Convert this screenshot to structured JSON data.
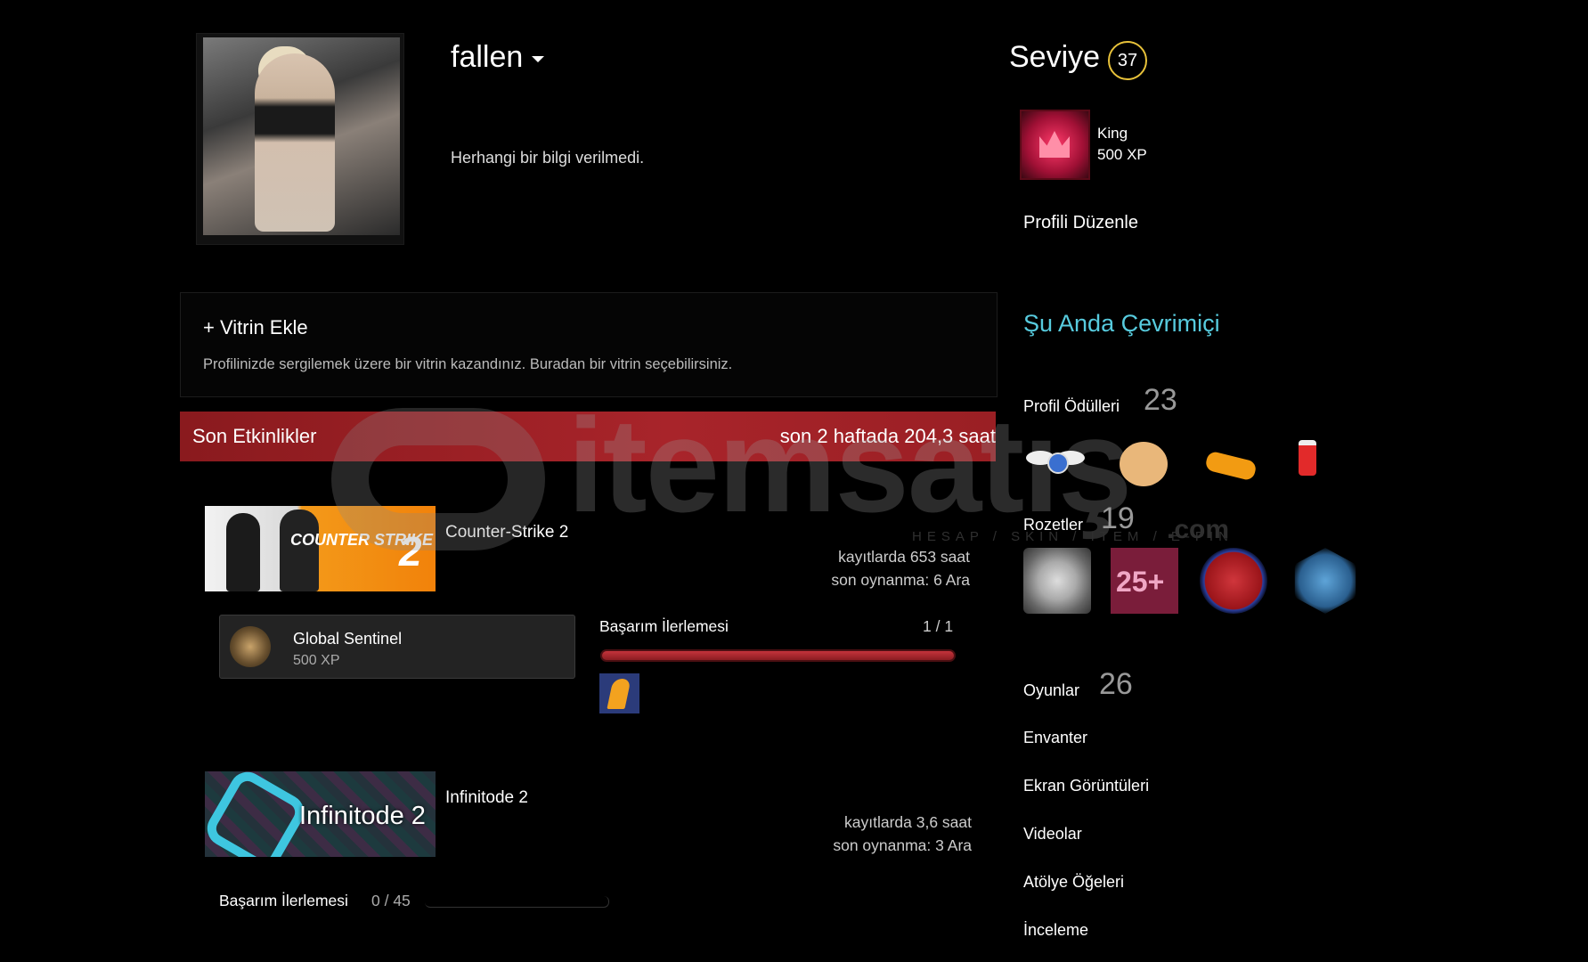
{
  "profile": {
    "username": "fallen",
    "summary": "Herhangi bir bilgi verilmedi."
  },
  "showcase": {
    "title": "+ Vitrin Ekle",
    "description": "Profilinizde sergilemek üzere bir vitrin kazandınız. Buradan bir vitrin seçebilirsiniz."
  },
  "activity": {
    "title": "Son Etkinlikler",
    "hours_summary": "son 2 haftada 204,3 saat",
    "games": [
      {
        "name": "Counter-Strike 2",
        "capsule_text": "COUNTER STRIKE",
        "capsule_number": "2",
        "hours": "kayıtlarda 653 saat",
        "last_played": "son oynanma: 6 Ara",
        "achievement": {
          "name": "Global Sentinel",
          "xp": "500 XP"
        },
        "progress_label": "Başarım İlerlemesi",
        "progress_count": "1 / 1",
        "progress_fraction": 1.0
      },
      {
        "name": "Infinitode 2",
        "capsule_text": "Infinitode 2",
        "hours": "kayıtlarda 3,6 saat",
        "last_played": "son oynanma: 3 Ara",
        "progress_label": "Başarım İlerlemesi",
        "progress_count": "0 / 45",
        "progress_fraction": 0.0
      }
    ]
  },
  "watermark": {
    "text": "itemsatış",
    "sub": "HESAP / SKIN / ITEM / E-PIN",
    "com": ".com"
  },
  "sidebar": {
    "level_label": "Seviye",
    "level": "37",
    "badge": {
      "name": "King",
      "xp": "500 XP"
    },
    "edit_profile": "Profili Düzenle",
    "status": "Şu Anda Çevrimiçi",
    "rewards": {
      "label": "Profil Ödülleri",
      "count": "23"
    },
    "badges": {
      "label": "Rozetler",
      "count": "19",
      "badge_25_text": "25+"
    },
    "games": {
      "label": "Oyunlar",
      "count": "26"
    },
    "links": [
      "Envanter",
      "Ekran Görüntüleri",
      "Videolar",
      "Atölye Öğeleri",
      "İnceleme"
    ]
  }
}
